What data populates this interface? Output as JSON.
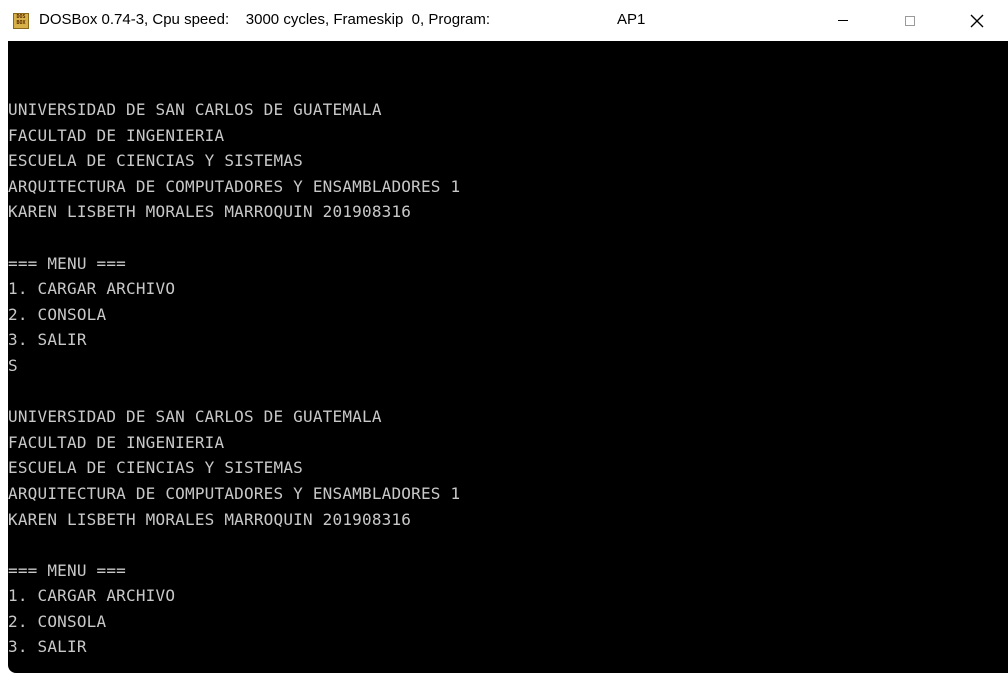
{
  "window": {
    "title": "DOSBox 0.74-3, Cpu speed:    3000 cycles, Frameskip  0, Program:",
    "program": "AP1",
    "icon": "dosbox-icon",
    "icon_text_top": "DOS",
    "icon_text_bottom": "BOX",
    "controls": {
      "minimize": "minimize-icon",
      "maximize": "maximize-icon",
      "close": "close-icon",
      "close_glyph": "✕"
    }
  },
  "console": {
    "background": "#000000",
    "text_color": "#c8c8c8",
    "lines": [
      "UNIVERSIDAD DE SAN CARLOS DE GUATEMALA",
      "FACULTAD DE INGENIERIA",
      "ESCUELA DE CIENCIAS Y SISTEMAS",
      "ARQUITECTURA DE COMPUTADORES Y ENSAMBLADORES 1",
      "KAREN LISBETH MORALES MARROQUIN 201908316",
      "",
      "=== MENU ===",
      "1. CARGAR ARCHIVO",
      "2. CONSOLA",
      "3. SALIR",
      "S",
      "",
      "UNIVERSIDAD DE SAN CARLOS DE GUATEMALA",
      "FACULTAD DE INGENIERIA",
      "ESCUELA DE CIENCIAS Y SISTEMAS",
      "ARQUITECTURA DE COMPUTADORES Y ENSAMBLADORES 1",
      "KAREN LISBETH MORALES MARROQUIN 201908316",
      "",
      "=== MENU ===",
      "1. CARGAR ARCHIVO",
      "2. CONSOLA",
      "3. SALIR"
    ]
  }
}
